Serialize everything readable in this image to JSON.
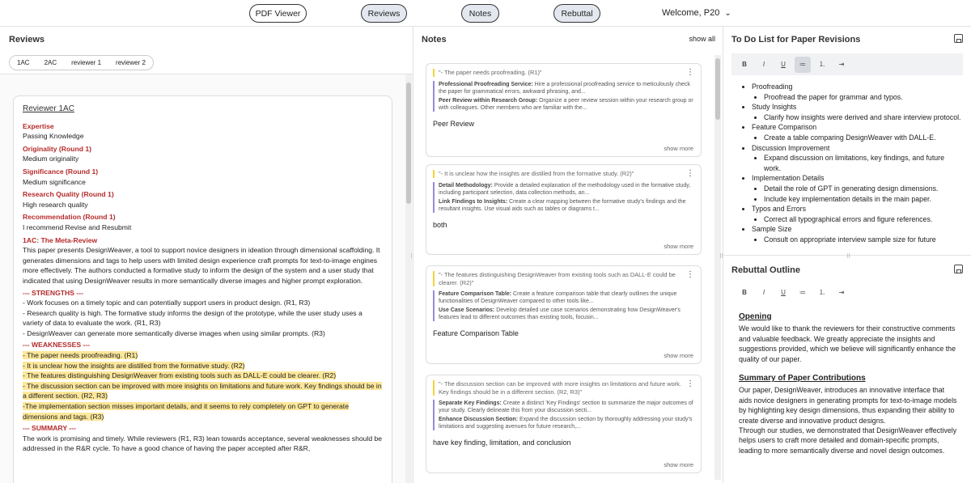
{
  "nav": {
    "pdf_viewer": "PDF Viewer",
    "reviews": "Reviews",
    "notes": "Notes",
    "rebuttal": "Rebuttal",
    "welcome": "Welcome, P20"
  },
  "reviews": {
    "title": "Reviews",
    "tabs": [
      "1AC",
      "2AC",
      "reviewer 1",
      "reviewer 2"
    ],
    "card": {
      "reviewer": "Reviewer 1AC",
      "fields": [
        {
          "k": "Expertise",
          "v": "Passing Knowledge"
        },
        {
          "k": "Originality (Round 1)",
          "v": "Medium originality"
        },
        {
          "k": "Significance (Round 1)",
          "v": "Medium significance"
        },
        {
          "k": "Research Quality (Round 1)",
          "v": "High research quality"
        },
        {
          "k": "Recommendation (Round 1)",
          "v": "I recommend Revise and Resubmit"
        }
      ],
      "meta_title": "1AC: The Meta-Review",
      "meta_body": "This paper presents DesignWeaver, a tool to support novice designers in ideation through dimensional scaffolding. It generates dimensions and tags to help users with limited design experience craft prompts for text-to-image engines more effectively. The authors conducted a formative study to inform the design of the system and a user study that indicated that using DesignWeaver results in more semantically diverse images and higher prompt exploration.",
      "strengths_title": "--- STRENGTHS ---",
      "strengths": [
        "- Work focuses on a timely topic and can potentially support users in product design. (R1, R3)",
        "- Research quality is high. The formative study informs the design of the prototype, while the user study uses a variety of data to evaluate the work. (R1, R3)",
        "- DesignWeaver can generate more semantically diverse images when using similar prompts. (R3)"
      ],
      "weaknesses_title": "--- WEAKNESSES ---",
      "weaknesses": [
        "- The paper needs proofreading. (R1)",
        "- It is unclear how the insights are distilled from the formative study. (R2)",
        "- The features distinguishing DesignWeaver from existing tools such as DALL-E could be clearer. (R2)",
        "- The discussion section can be improved with more insights on limitations and future work. Key findings should be in a different section. (R2, R3)",
        "-The implementation section misses important details, and it seems to rely completely on GPT to generate dimensions and tags. (R3)"
      ],
      "summary_title": "--- SUMMARY ---",
      "summary": "The work is promising and timely. While reviewers (R1, R3) lean towards acceptance, several weaknesses should be addressed in the R&R cycle. To have a good chance of having the paper accepted after R&R,"
    }
  },
  "notes": {
    "title": "Notes",
    "show_all": "show all",
    "show_more": "show more",
    "items": [
      {
        "quote": "\"- The paper needs proofreading. (R1)\"",
        "s1_title": "Professional Proofreading Service:",
        "s1": " Hire a professional proofreading service to meticulously check the paper for grammatical errors, awkward phrasing, and...",
        "s2_title": "Peer Review within Research Group:",
        "s2": " Organize a peer review session within your research group or with colleagues. Other members who are familiar with the...",
        "text": "Peer Review"
      },
      {
        "quote": "\"- It is unclear how the insights are distilled from the formative study. (R2)\"",
        "s1_title": "Detail Methodology:",
        "s1": " Provide a detailed explanation of the methodology used in the formative study, including participant selection, data collection methods, an...",
        "s2_title": "Link Findings to Insights:",
        "s2": " Create a clear mapping between the formative study's findings and the resultant insights. Use visual aids such as tables or diagrams t...",
        "text": "both"
      },
      {
        "quote": "\"- The features distinguishing DesignWeaver from existing tools such as DALL-E could be clearer. (R2)\"",
        "s1_title": "Feature Comparison Table:",
        "s1": " Create a feature comparison table that clearly outlines the unique functionalities of DesignWeaver compared to other tools like...",
        "s2_title": "Use Case Scenarios:",
        "s2": " Develop detailed use case scenarios demonstrating how DesignWeaver's features lead to different outcomes than existing tools, focusin...",
        "text": "Feature Comparison Table"
      },
      {
        "quote": "\"- The discussion section can be improved with more insights on limitations and future work. Key findings should be in a different section. (R2, R3)\"",
        "s1_title": "Separate Key Findings:",
        "s1": " Create a distinct 'Key Findings' section to summarize the major outcomes of your study. Clearly delineate this from your discussion secti...",
        "s2_title": "Enhance Discussion Section:",
        "s2": " Expand the discussion section by thoroughly addressing your study's limitations and suggesting avenues for future research,...",
        "text": "have key finding, limitation, and conclusion"
      }
    ]
  },
  "todo": {
    "title": "To Do List for Paper Revisions",
    "toolbar": [
      "B",
      "I",
      "U",
      "≔",
      "⒈",
      "⇥"
    ],
    "items": [
      {
        "label": "Proofreading",
        "subs": [
          "Proofread the paper for grammar and typos."
        ]
      },
      {
        "label": "Study Insights",
        "subs": [
          "Clarify how insights were derived and share interview protocol."
        ]
      },
      {
        "label": "Feature Comparison",
        "subs": [
          "Create a table comparing DesignWeaver with DALL-E."
        ]
      },
      {
        "label": "Discussion Improvement",
        "subs": [
          "Expand discussion on limitations, key findings, and future work."
        ]
      },
      {
        "label": "Implementation Details",
        "subs": [
          "Detail the role of GPT in generating design dimensions.",
          "Include key implementation details in the main paper."
        ]
      },
      {
        "label": "Typos and Errors",
        "subs": [
          "Correct all typographical errors and figure references."
        ]
      },
      {
        "label": "Sample Size",
        "subs": [
          "Consult on appropriate interview sample size for future"
        ]
      }
    ]
  },
  "rebuttal": {
    "title": "Rebuttal Outline",
    "opening_title": "Opening",
    "opening": "We would like to thank the reviewers for their constructive comments and valuable feedback. We greatly appreciate the insights and suggestions provided, which we believe will significantly enhance the quality of our paper.",
    "summary_title": "Summary of Paper Contributions",
    "summary_1": "Our paper, DesignWeaver, introduces an innovative interface that aids novice designers in generating prompts for text-to-image models by highlighting key design dimensions, thus expanding their ability to create diverse and innovative product designs.",
    "summary_2": "Through our studies, we demonstrated that DesignWeaver effectively helps users to craft more detailed and domain-specific prompts, leading to more semantically diverse and novel design outcomes."
  }
}
